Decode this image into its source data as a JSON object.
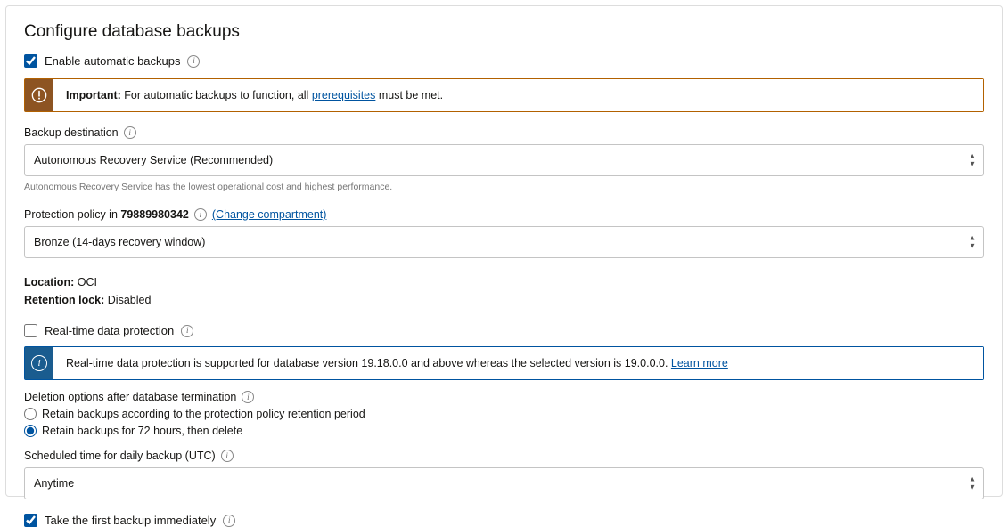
{
  "title": "Configure database backups",
  "enableAutomatic": {
    "label": "Enable automatic backups",
    "checked": true
  },
  "importantAlert": {
    "strong": "Important:",
    "text_before": " For automatic backups to function, all ",
    "link": "prerequisites",
    "text_after": " must be met."
  },
  "backupDestination": {
    "label": "Backup destination",
    "value": "Autonomous Recovery Service (Recommended)",
    "helper": "Autonomous Recovery Service has the lowest operational cost and highest performance."
  },
  "protectionPolicy": {
    "label_prefix": "Protection policy in ",
    "compartment": "79889980342",
    "changeLink": "(Change compartment)",
    "value": "Bronze (14-days recovery window)"
  },
  "location": {
    "label": "Location:",
    "value": " OCI"
  },
  "retentionLock": {
    "label": "Retention lock:",
    "value": " Disabled"
  },
  "realtime": {
    "label": "Real-time data protection",
    "checked": false
  },
  "realtimeAlert": {
    "text": "Real-time data protection is supported for database version 19.18.0.0 and above whereas the selected version is 19.0.0.0. ",
    "link": "Learn more"
  },
  "deletionOptions": {
    "label": "Deletion options after database termination",
    "option1": "Retain backups according to the protection policy retention period",
    "option2": "Retain backups for 72 hours, then delete",
    "selected": "option2"
  },
  "scheduledTime": {
    "label": "Scheduled time for daily backup (UTC)",
    "value": "Anytime"
  },
  "firstBackup": {
    "label": "Take the first backup immediately",
    "checked": true
  }
}
